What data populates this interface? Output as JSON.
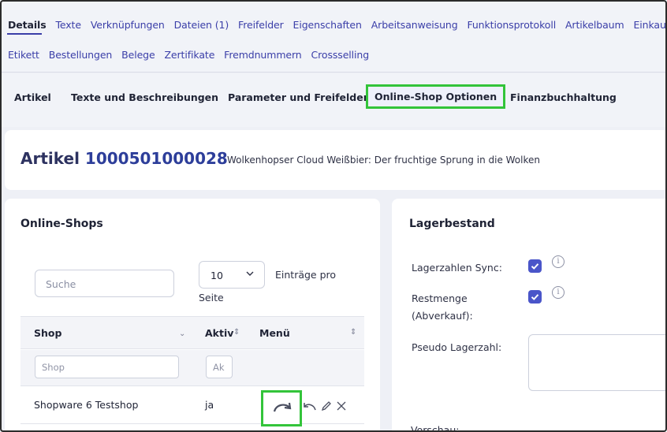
{
  "tabs_row1": [
    {
      "label": "Details",
      "active": true
    },
    {
      "label": "Texte"
    },
    {
      "label": "Verknüpfungen"
    },
    {
      "label": "Dateien (1)"
    },
    {
      "label": "Freifelder"
    },
    {
      "label": "Eigenschaften"
    },
    {
      "label": "Arbeitsanweisung"
    },
    {
      "label": "Funktionsprotokoll"
    },
    {
      "label": "Artikelbaum"
    },
    {
      "label": "Einkauf"
    }
  ],
  "tabs_row2": [
    {
      "label": "Etikett"
    },
    {
      "label": "Bestellungen"
    },
    {
      "label": "Belege"
    },
    {
      "label": "Zertifikate"
    },
    {
      "label": "Fremdnummern"
    },
    {
      "label": "Crossselling"
    }
  ],
  "subtabs": [
    {
      "label": "Artikel"
    },
    {
      "label": "Texte und Beschreibungen"
    },
    {
      "label": "Parameter und Freifelder"
    },
    {
      "label": "Online-Shop Optionen",
      "highlighted": true
    },
    {
      "label": "Finanzbuchhaltung"
    }
  ],
  "article": {
    "prefix": "Artikel",
    "number": "1000501000028",
    "description": "Wolkenhopser Cloud Weißbier: Der fruchtige Sprung in die Wolken"
  },
  "online_shops": {
    "title": "Online-Shops",
    "search_placeholder": "Suche",
    "page_size": "10",
    "per_page_a": "Einträge pro",
    "per_page_b": "Seite",
    "columns": [
      "Shop",
      "Aktiv",
      "Menü"
    ],
    "filter_shop_placeholder": "Shop",
    "filter_aktiv_placeholder": "Ak",
    "rows": [
      {
        "shop": "Shopware 6 Testshop",
        "aktiv": "ja"
      }
    ]
  },
  "lagerbestand": {
    "title": "Lagerbestand",
    "sync_label": "Lagerzahlen Sync:",
    "sync_checked": true,
    "rest_label_a": "Restmenge",
    "rest_label_b": "(Abverkauf):",
    "rest_checked": true,
    "pseudo_label": "Pseudo Lagerzahl:",
    "pseudo_value": "",
    "vorschau_label": "Vorschau:"
  },
  "colors": {
    "accent": "#3a3ea8",
    "highlight": "#33c43a",
    "checkbox": "#4a55c9"
  }
}
